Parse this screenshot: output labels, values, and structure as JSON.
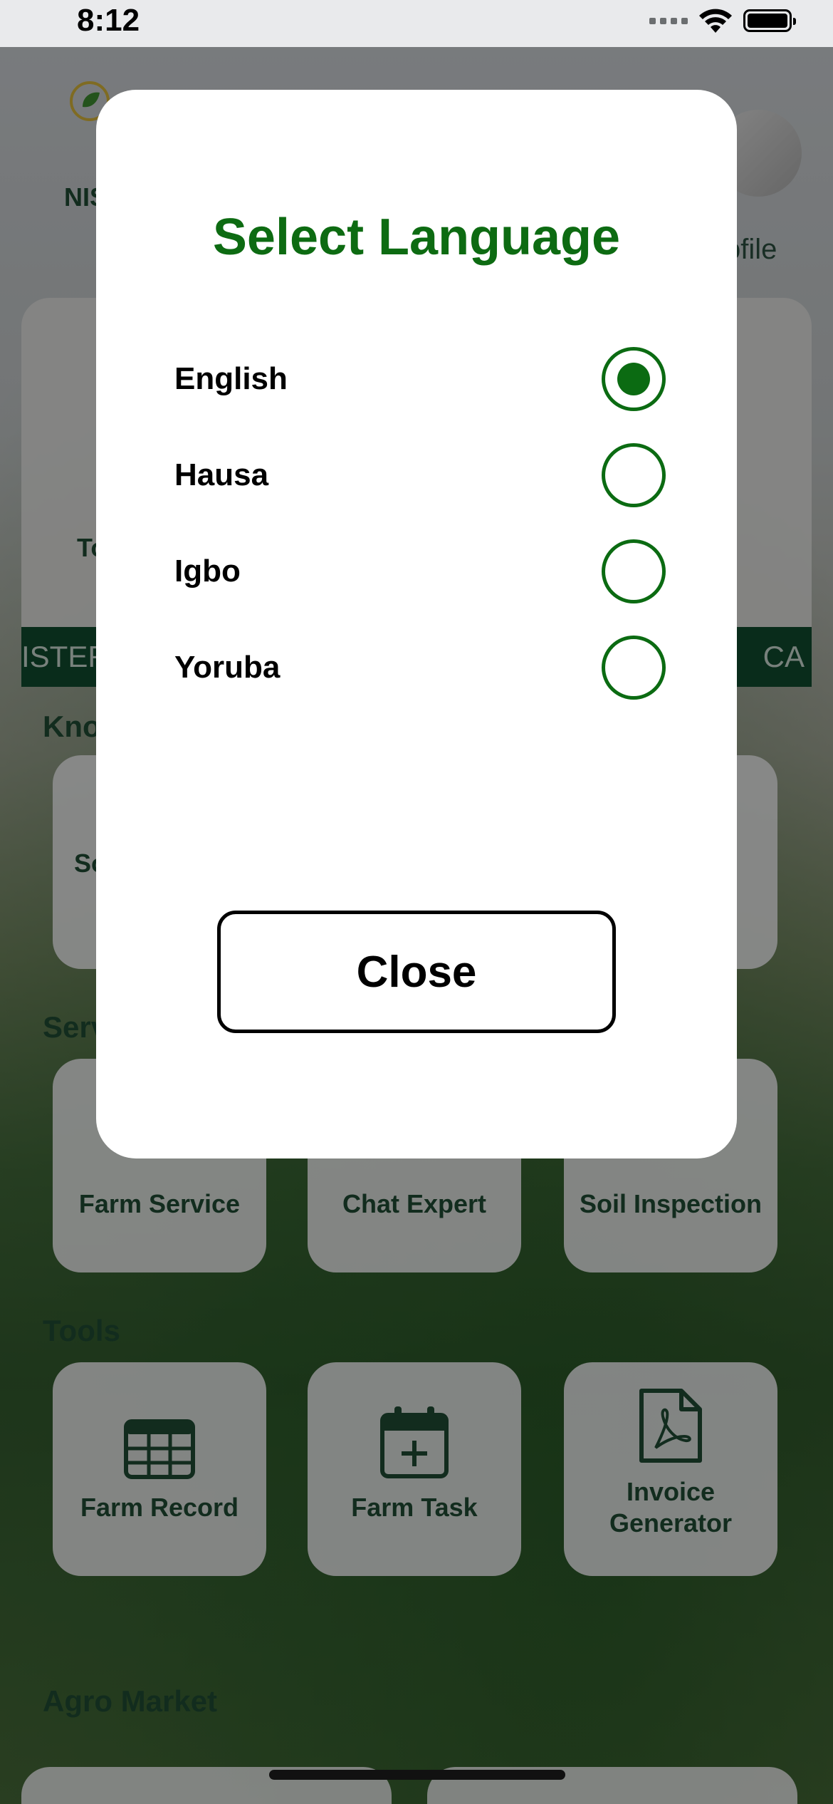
{
  "status_bar": {
    "time": "8:12"
  },
  "header": {
    "logo_text": "NIS",
    "profile_label": "ofile"
  },
  "hero": {
    "text": "To"
  },
  "ticker": {
    "left_text": "ISTER",
    "right_text": "CA"
  },
  "sections": {
    "knowledge_title": "Kno",
    "knowledge_tile_label": "So",
    "services_title": "Serv",
    "services": [
      {
        "label": "Farm Service"
      },
      {
        "label": "Chat Expert"
      },
      {
        "label": "Soil Inspection"
      }
    ],
    "tools_title": "Tools",
    "tools": [
      {
        "label": "Farm Record",
        "icon": "table-icon"
      },
      {
        "label": "Farm Task",
        "icon": "calendar-add-icon"
      },
      {
        "label": "Invoice Generator",
        "icon": "pdf-file-icon"
      }
    ],
    "agro_market_title": "Agro Market"
  },
  "modal": {
    "title": "Select Language",
    "options": [
      {
        "label": "English",
        "selected": true
      },
      {
        "label": "Hausa",
        "selected": false
      },
      {
        "label": "Igbo",
        "selected": false
      },
      {
        "label": "Yoruba",
        "selected": false
      }
    ],
    "close_label": "Close"
  },
  "colors": {
    "accent_green": "#0d6b12",
    "dark_green": "#1f4a33",
    "ticker_bg": "#0f4a2e"
  }
}
